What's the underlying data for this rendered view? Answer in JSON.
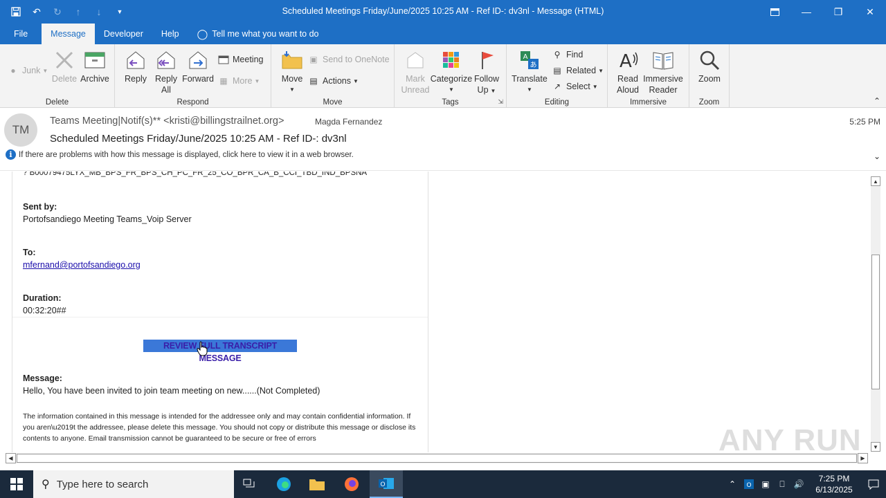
{
  "window": {
    "title": "Scheduled Meetings Friday/June/2025 10:25 AM - Ref ID-: dv3nl  -  Message (HTML)"
  },
  "tabs": [
    {
      "label": "File"
    },
    {
      "label": "Message"
    },
    {
      "label": "Developer"
    },
    {
      "label": "Help"
    },
    {
      "label": "Tell me what you want to do"
    }
  ],
  "ribbon": {
    "delete_group": {
      "label": "Delete",
      "junk": "Junk",
      "delete": "Delete",
      "archive": "Archive"
    },
    "respond_group": {
      "label": "Respond",
      "reply": "Reply",
      "reply_all_1": "Reply",
      "reply_all_2": "All",
      "forward": "Forward",
      "meeting": "Meeting",
      "more": "More"
    },
    "move_group": {
      "label": "Move",
      "move": "Move",
      "onenote": "Send to OneNote",
      "actions": "Actions"
    },
    "tags_group": {
      "label": "Tags",
      "mark_unread_1": "Mark",
      "mark_unread_2": "Unread",
      "categorize": "Categorize",
      "follow_up_1": "Follow",
      "follow_up_2": "Up"
    },
    "editing_group": {
      "label": "Editing",
      "translate": "Translate",
      "find": "Find",
      "related": "Related",
      "select": "Select"
    },
    "immersive_group": {
      "label": "Immersive",
      "read_aloud_1": "Read",
      "read_aloud_2": "Aloud",
      "immersive_reader_1": "Immersive",
      "immersive_reader_2": "Reader"
    },
    "zoom_group": {
      "label": "Zoom",
      "zoom": "Zoom"
    }
  },
  "message": {
    "avatar_initials": "TM",
    "from": "Teams Meeting|Notif(s)** <kristi@billingstrailnet.org>",
    "to_name": "Magda Fernandez",
    "subject": "Scheduled Meetings Friday/June/2025 10:25 AM - Ref ID-: dv3nl",
    "time": "5:25 PM",
    "info_bar": "If there are problems with how this message is displayed, click here to view it in a web browser."
  },
  "body": {
    "cut_line": "? B00079475LYX_MB_BPS_FR_BPS_CH_PC_FR_25_CO_BPR_CA_B_CCI_TBD_IND_BPSNA",
    "sent_by_label": "Sent by:",
    "sent_by_value": "Portofsandiego Meeting Teams_Voip Server",
    "to_label": "To:",
    "to_value": "mfernand@portofsandiego.org",
    "duration_label": "Duration:",
    "duration_value": "00:32:20##",
    "cta": "REVIEW FULL TRANSCRIPT MESSAGE",
    "message_label": "Message:",
    "message_value": "Hello, You have been invited to join team meeting on new......(Not Completed)",
    "disclaimer": "The information contained in this message is intended for the addressee only and may contain confidential information. If you aren\\u2019t the addressee, please delete this message. You should not copy or distribute this message or disclose its contents to anyone. Email transmission cannot be guaranteed to be secure or free of errors"
  },
  "watermark": "ANY RUN",
  "taskbar": {
    "search_placeholder": "Type here to search",
    "time": "7:25 PM",
    "date": "6/13/2025"
  },
  "colors": {
    "accent": "#1e6fc5",
    "taskbar": "#1b2a3c",
    "cta_bg": "#3b78d8"
  }
}
